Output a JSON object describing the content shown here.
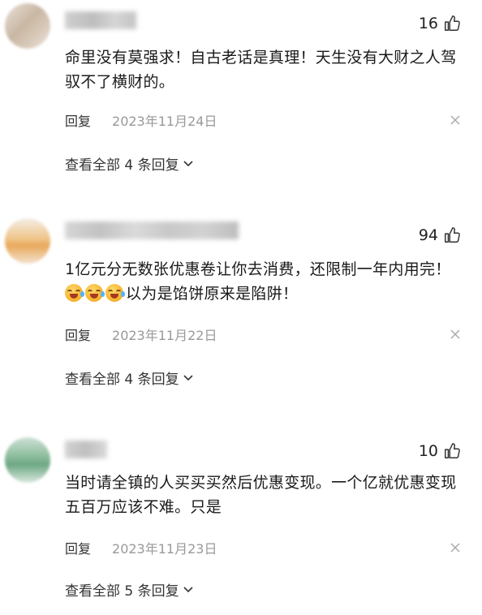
{
  "comments": [
    {
      "likes": "16",
      "text": "命里没有莫强求！自古老话是真理！天生没有大财之人驾驭不了横财的。",
      "reply_label": "回复",
      "date": "2023年11月24日",
      "expand_label": "查看全部 4 条回复"
    },
    {
      "likes": "94",
      "text_part1": "1亿元分无数张优惠卷让你去消费，还限制一年内用完！",
      "text_part2": "以为是馅饼原来是陷阱！",
      "emoji_count": 3,
      "reply_label": "回复",
      "date": "2023年11月22日",
      "expand_label": "查看全部 4 条回复"
    },
    {
      "likes": "10",
      "text": "当时请全镇的人买买买然后优惠变现。一个亿就优惠变现五百万应该不难。只是",
      "reply_label": "回复",
      "date": "2023年11月23日",
      "expand_label": "查看全部 5 条回复"
    }
  ],
  "icons": {
    "like": "thumbs-up-icon",
    "close": "close-icon",
    "chevron": "chevron-down-icon",
    "emoji": "laughing-crying-emoji"
  },
  "colors": {
    "text": "#1a1a1a",
    "meta": "#999999",
    "background": "#ffffff"
  }
}
